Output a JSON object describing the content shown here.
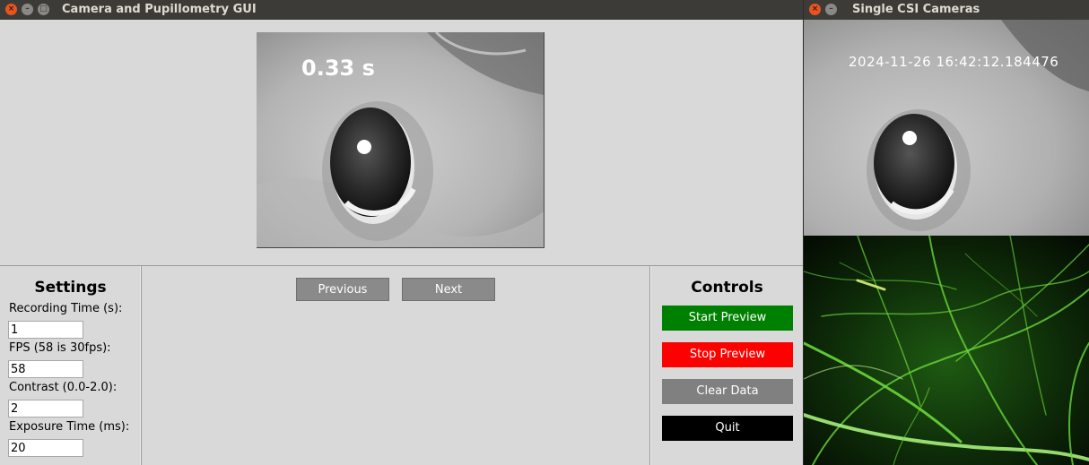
{
  "main_window": {
    "title": "Camera and Pupillometry GUI",
    "buttons": {
      "close": "×",
      "minimize": "–",
      "maximize": "□"
    },
    "eye_frame": {
      "time_overlay": "0.33 s"
    },
    "settings": {
      "heading": "Settings",
      "fields": [
        {
          "label": "Recording Time (s):",
          "value": "1"
        },
        {
          "label": "FPS (58 is 30fps):",
          "value": "58"
        },
        {
          "label": "Contrast (0.0-2.0):",
          "value": "2"
        },
        {
          "label": "Exposure Time (ms):",
          "value": "20"
        }
      ]
    },
    "navigation": {
      "previous": "Previous",
      "next": "Next"
    },
    "controls": {
      "heading": "Controls",
      "start_preview": "Start Preview",
      "stop_preview": "Stop Preview",
      "clear_data": "Clear Data",
      "quit": "Quit"
    }
  },
  "camera_window": {
    "title": "Single CSI Cameras",
    "buttons": {
      "close": "×",
      "minimize": "–"
    },
    "timestamp": "2024-11-26  16:42:12.184476"
  },
  "colors": {
    "start_preview": "#008000",
    "stop_preview": "#ff0000",
    "clear_data": "#808080",
    "quit": "#000000",
    "titlebar": "#3c3b37",
    "window_bg": "#d9d9d9"
  }
}
